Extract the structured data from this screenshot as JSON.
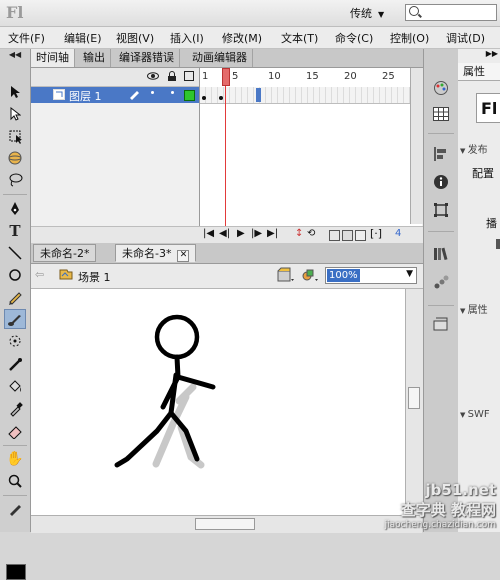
{
  "app": {
    "logo_text": "Fl",
    "workspace": "传统",
    "search_placeholder": ""
  },
  "menu": [
    "文件(F)",
    "编辑(E)",
    "视图(V)",
    "插入(I)",
    "修改(M)",
    "文本(T)",
    "命令(C)",
    "控制(O)",
    "调试(D)"
  ],
  "panel_tabs": [
    "时间轴",
    "输出",
    "编译器错误",
    "动画编辑器"
  ],
  "timeline": {
    "layer_name": "图层 1",
    "frame_numbers": [
      "1",
      "5",
      "10",
      "15",
      "20",
      "25"
    ],
    "current_frame": "4",
    "current_frame_label": "4"
  },
  "doc_tabs": [
    {
      "label": "未命名-2*",
      "active": false
    },
    {
      "label": "未命名-3*",
      "active": true
    }
  ],
  "editbar": {
    "scene": "场景 1",
    "zoom": "100%"
  },
  "properties": {
    "tab": "属性",
    "logo": "Fl",
    "section_publish": "发布",
    "config_label": "配置",
    "player_label": "播",
    "section_props": "属性",
    "section_swf": "SWF"
  },
  "watermark": {
    "line1": "查字典 教程网",
    "line2": "jb51.net",
    "line3": "jiaocheng.chazidian.com"
  },
  "colors": {
    "accent": "#4a78c6",
    "playhead": "#e23a3a",
    "fill_swatch": "#000000"
  }
}
